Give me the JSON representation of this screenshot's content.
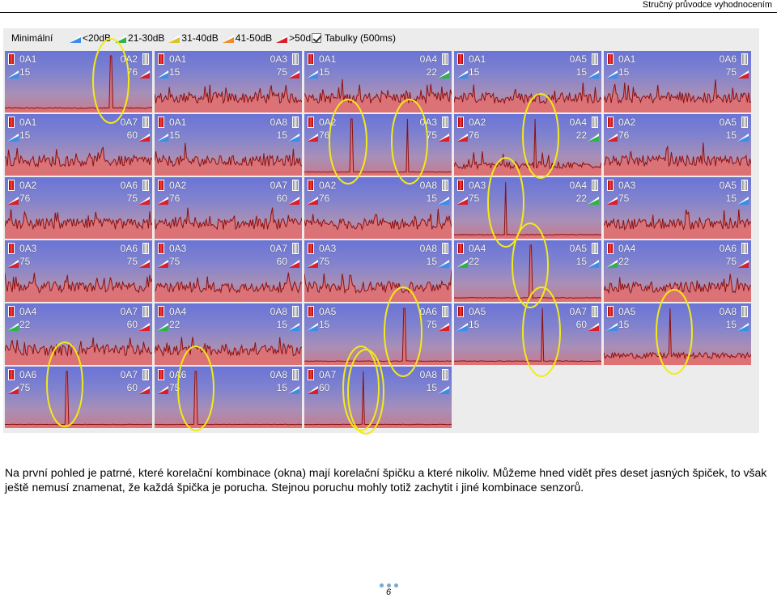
{
  "header": {
    "title": "Stručný průvodce vyhodnocením"
  },
  "toolbar": {
    "mode": "Minimální",
    "legend": [
      {
        "label": "<20dB",
        "color": "#3a8ee6"
      },
      {
        "label": "21-30dB",
        "color": "#2db34a"
      },
      {
        "label": "31-40dB",
        "color": "#d9c52b"
      },
      {
        "label": "41-50dB",
        "color": "#f08b2a"
      },
      {
        "label": ">50dB",
        "color": "#d8202a"
      }
    ],
    "checkbox_label": "Tabulky (500ms)",
    "checkbox_checked": true
  },
  "tiles": [
    {
      "s1": "0A1",
      "s2": "0A2",
      "v1": "15",
      "v2": "76",
      "c1": "#3a8ee6",
      "c2": "#d8202a",
      "spike": 0.72,
      "noise": 0.06
    },
    {
      "s1": "0A1",
      "s2": "0A3",
      "v1": "15",
      "v2": "75",
      "c1": "#3a8ee6",
      "c2": "#d8202a",
      "spike": null,
      "noise": 0.55
    },
    {
      "s1": "0A1",
      "s2": "0A4",
      "v1": "15",
      "v2": "22",
      "c1": "#3a8ee6",
      "c2": "#2db34a",
      "spike": null,
      "noise": 0.55
    },
    {
      "s1": "0A1",
      "s2": "0A5",
      "v1": "15",
      "v2": "15",
      "c1": "#3a8ee6",
      "c2": "#3a8ee6",
      "spike": null,
      "noise": 0.55
    },
    {
      "s1": "0A1",
      "s2": "0A6",
      "v1": "15",
      "v2": "75",
      "c1": "#3a8ee6",
      "c2": "#d8202a",
      "spike": null,
      "noise": 0.55
    },
    {
      "s1": "0A1",
      "s2": "0A7",
      "v1": "15",
      "v2": "60",
      "c1": "#3a8ee6",
      "c2": "#d8202a",
      "spike": null,
      "noise": 0.55
    },
    {
      "s1": "0A1",
      "s2": "0A8",
      "v1": "15",
      "v2": "15",
      "c1": "#3a8ee6",
      "c2": "#3a8ee6",
      "spike": null,
      "noise": 0.55
    },
    {
      "s1": "0A2",
      "s2": "0A3",
      "v1": "76",
      "v2": "75",
      "c1": "#d8202a",
      "c2": "#d8202a",
      "spike": 0.32,
      "noise": 0.02,
      "spike2": 0.7
    },
    {
      "s1": "0A2",
      "s2": "0A4",
      "v1": "76",
      "v2": "22",
      "c1": "#d8202a",
      "c2": "#2db34a",
      "spike": 0.55,
      "noise": 0.35
    },
    {
      "s1": "0A2",
      "s2": "0A5",
      "v1": "76",
      "v2": "15",
      "c1": "#d8202a",
      "c2": "#3a8ee6",
      "spike": null,
      "noise": 0.55
    },
    {
      "s1": "0A2",
      "s2": "0A6",
      "v1": "76",
      "v2": "75",
      "c1": "#d8202a",
      "c2": "#d8202a",
      "spike": null,
      "noise": 0.55
    },
    {
      "s1": "0A2",
      "s2": "0A7",
      "v1": "76",
      "v2": "60",
      "c1": "#d8202a",
      "c2": "#d8202a",
      "spike": null,
      "noise": 0.55
    },
    {
      "s1": "0A2",
      "s2": "0A8",
      "v1": "76",
      "v2": "15",
      "c1": "#d8202a",
      "c2": "#3a8ee6",
      "spike": null,
      "noise": 0.55
    },
    {
      "s1": "0A3",
      "s2": "0A4",
      "v1": "75",
      "v2": "22",
      "c1": "#d8202a",
      "c2": "#2db34a",
      "spike": 0.35,
      "noise": 0.04
    },
    {
      "s1": "0A3",
      "s2": "0A5",
      "v1": "75",
      "v2": "15",
      "c1": "#d8202a",
      "c2": "#3a8ee6",
      "spike": null,
      "noise": 0.55
    },
    {
      "s1": "0A3",
      "s2": "0A6",
      "v1": "75",
      "v2": "75",
      "c1": "#d8202a",
      "c2": "#d8202a",
      "spike": null,
      "noise": 0.55
    },
    {
      "s1": "0A3",
      "s2": "0A7",
      "v1": "75",
      "v2": "60",
      "c1": "#d8202a",
      "c2": "#d8202a",
      "spike": null,
      "noise": 0.55
    },
    {
      "s1": "0A3",
      "s2": "0A8",
      "v1": "75",
      "v2": "15",
      "c1": "#d8202a",
      "c2": "#3a8ee6",
      "spike": null,
      "noise": 0.55
    },
    {
      "s1": "0A4",
      "s2": "0A5",
      "v1": "22",
      "v2": "15",
      "c1": "#2db34a",
      "c2": "#3a8ee6",
      "spike": 0.52,
      "noise": 0.04
    },
    {
      "s1": "0A4",
      "s2": "0A6",
      "v1": "22",
      "v2": "75",
      "c1": "#2db34a",
      "c2": "#d8202a",
      "spike": null,
      "noise": 0.55
    },
    {
      "s1": "0A4",
      "s2": "0A7",
      "v1": "22",
      "v2": "60",
      "c1": "#2db34a",
      "c2": "#d8202a",
      "spike": null,
      "noise": 0.55
    },
    {
      "s1": "0A4",
      "s2": "0A8",
      "v1": "22",
      "v2": "15",
      "c1": "#2db34a",
      "c2": "#3a8ee6",
      "spike": null,
      "noise": 0.55
    },
    {
      "s1": "0A5",
      "s2": "0A6",
      "v1": "15",
      "v2": "75",
      "c1": "#3a8ee6",
      "c2": "#d8202a",
      "spike": 0.68,
      "noise": 0.03
    },
    {
      "s1": "0A5",
      "s2": "0A7",
      "v1": "15",
      "v2": "60",
      "c1": "#3a8ee6",
      "c2": "#d8202a",
      "spike": 0.6,
      "noise": 0.03
    },
    {
      "s1": "0A5",
      "s2": "0A8",
      "v1": "15",
      "v2": "15",
      "c1": "#3a8ee6",
      "c2": "#3a8ee6",
      "spike": 0.45,
      "noise": 0.3
    },
    {
      "s1": "0A6",
      "s2": "0A7",
      "v1": "75",
      "v2": "60",
      "c1": "#d8202a",
      "c2": "#d8202a",
      "spike": 0.42,
      "noise": 0.02
    },
    {
      "s1": "0A6",
      "s2": "0A8",
      "v1": "75",
      "v2": "15",
      "c1": "#d8202a",
      "c2": "#3a8ee6",
      "spike": 0.28,
      "noise": 0.02
    },
    {
      "s1": "0A7",
      "s2": "0A8",
      "v1": "60",
      "v2": "15",
      "c1": "#d8202a",
      "c2": "#3a8ee6",
      "spike": 0.4,
      "noise": 0.02
    }
  ],
  "caption": "Na první pohled je patrné, které korelační kombinace (okna) mají korelační špičku a které nikoliv. Můžeme hned vidět přes deset jasných špiček, to však ještě nemusí znamenat, že každá špička je porucha. Stejnou poruchu mohly totiž zachytit i jiné kombinace senzorů.",
  "footer": {
    "page_number": "6"
  }
}
